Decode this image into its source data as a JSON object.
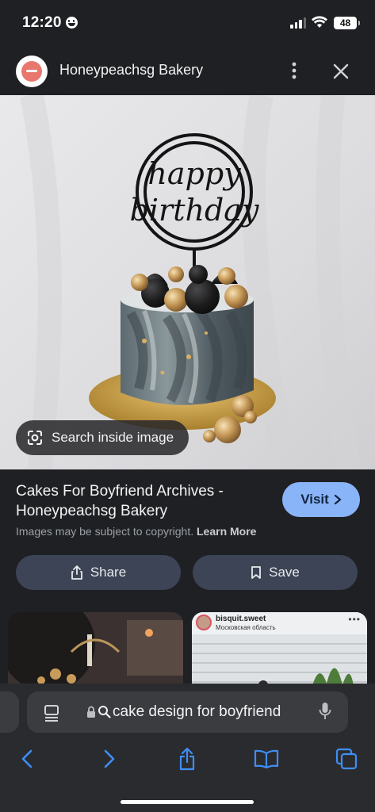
{
  "status_bar": {
    "time": "12:20",
    "battery": "48"
  },
  "header": {
    "title": "Honeypeachsg Bakery",
    "more_icon": "more-vert-icon",
    "close_icon": "close-icon"
  },
  "image": {
    "topper_line1": "happy",
    "topper_line2": "birthday",
    "search_inside_label": "Search inside image"
  },
  "details": {
    "title": "Cakes For Boyfriend Archives - Honeypeachsg Bakery",
    "visit_label": "Visit",
    "copyright_text": "Images may be subject to copyright.",
    "learn_more_label": "Learn More",
    "share_label": "Share",
    "save_label": "Save"
  },
  "related": [
    {
      "username": "",
      "location": ""
    },
    {
      "username": "bisquit.sweet",
      "location": "Московская область"
    }
  ],
  "safari": {
    "url_text": "cake design for boyfriend",
    "colors": {
      "accent": "#8ab4f8",
      "nav_blue": "#3e8ef7",
      "chip": "#3c4455"
    }
  }
}
